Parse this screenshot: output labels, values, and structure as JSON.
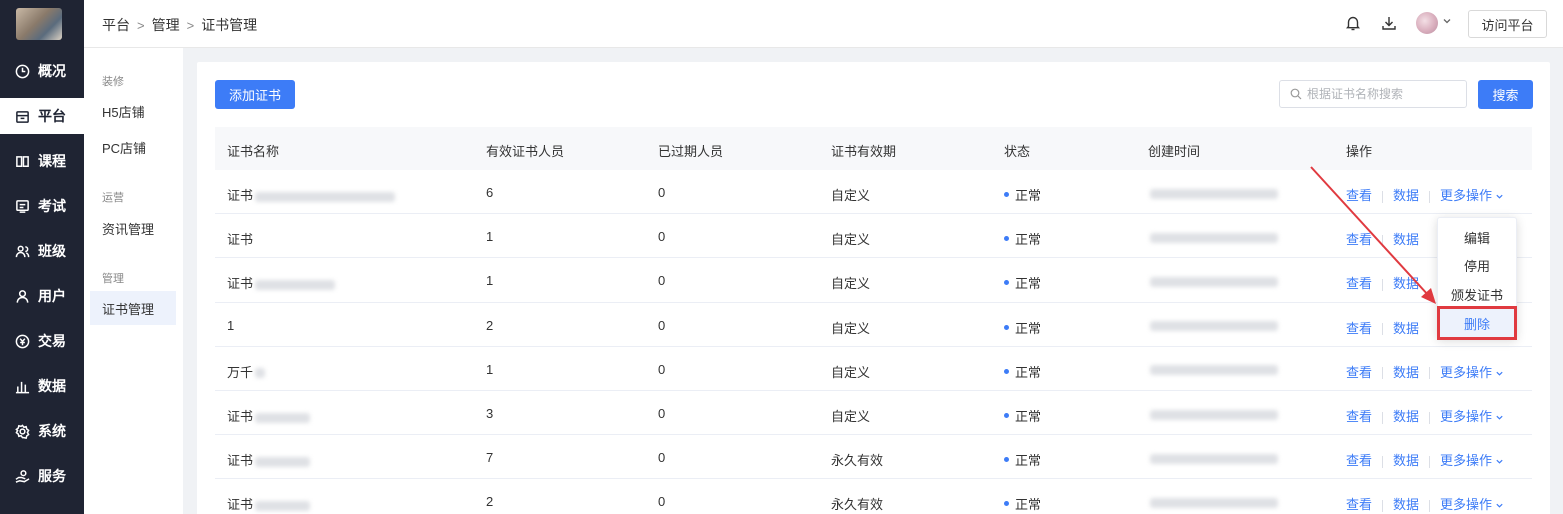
{
  "nav": {
    "items": [
      {
        "label": "概况",
        "icon": "overview-icon"
      },
      {
        "label": "平台",
        "icon": "store-icon"
      },
      {
        "label": "课程",
        "icon": "book-icon"
      },
      {
        "label": "考试",
        "icon": "exam-icon"
      },
      {
        "label": "班级",
        "icon": "class-icon"
      },
      {
        "label": "用户",
        "icon": "user-icon"
      },
      {
        "label": "交易",
        "icon": "trade-icon"
      },
      {
        "label": "数据",
        "icon": "chart-icon"
      },
      {
        "label": "系统",
        "icon": "settings-icon"
      },
      {
        "label": "服务",
        "icon": "service-icon"
      }
    ],
    "active_label": "平台"
  },
  "header": {
    "breadcrumb": [
      "平台",
      "管理",
      "证书管理"
    ],
    "visit_button": "访问平台"
  },
  "subnav": {
    "groups": [
      {
        "title": "装修",
        "items": [
          "H5店铺",
          "PC店铺"
        ]
      },
      {
        "title": "运营",
        "items": [
          "资讯管理"
        ]
      },
      {
        "title": "管理",
        "items": [
          "证书管理"
        ]
      }
    ],
    "active_item": "证书管理"
  },
  "toolbar": {
    "add_button": "添加证书",
    "search_placeholder": "根据证书名称搜索",
    "search_button": "搜索"
  },
  "table": {
    "columns": [
      "证书名称",
      "有效证书人员",
      "已过期人员",
      "证书有效期",
      "状态",
      "创建时间",
      "操作"
    ],
    "rows": [
      {
        "name": "证书",
        "valid": "6",
        "expired": "0",
        "period": "自定义",
        "status": "正常"
      },
      {
        "name": "证书",
        "valid": "1",
        "expired": "0",
        "period": "自定义",
        "status": "正常"
      },
      {
        "name": "证书",
        "valid": "1",
        "expired": "0",
        "period": "自定义",
        "status": "正常"
      },
      {
        "name": "1",
        "valid": "2",
        "expired": "0",
        "period": "自定义",
        "status": "正常"
      },
      {
        "name": "万千",
        "valid": "1",
        "expired": "0",
        "period": "自定义",
        "status": "正常"
      },
      {
        "name": "证书",
        "valid": "3",
        "expired": "0",
        "period": "自定义",
        "status": "正常"
      },
      {
        "name": "证书",
        "valid": "7",
        "expired": "0",
        "period": "永久有效",
        "status": "正常"
      },
      {
        "name": "证书",
        "valid": "2",
        "expired": "0",
        "period": "永久有效",
        "status": "正常"
      }
    ],
    "actions": {
      "view": "查看",
      "data": "数据",
      "more": "更多操作"
    }
  },
  "dropdown": {
    "items": [
      "编辑",
      "停用",
      "颁发证书",
      "删除"
    ],
    "highlighted": "删除"
  },
  "colors": {
    "primary": "#3d7cf7",
    "nav_bg": "#1f2433",
    "annotation_red": "#e03a40"
  }
}
